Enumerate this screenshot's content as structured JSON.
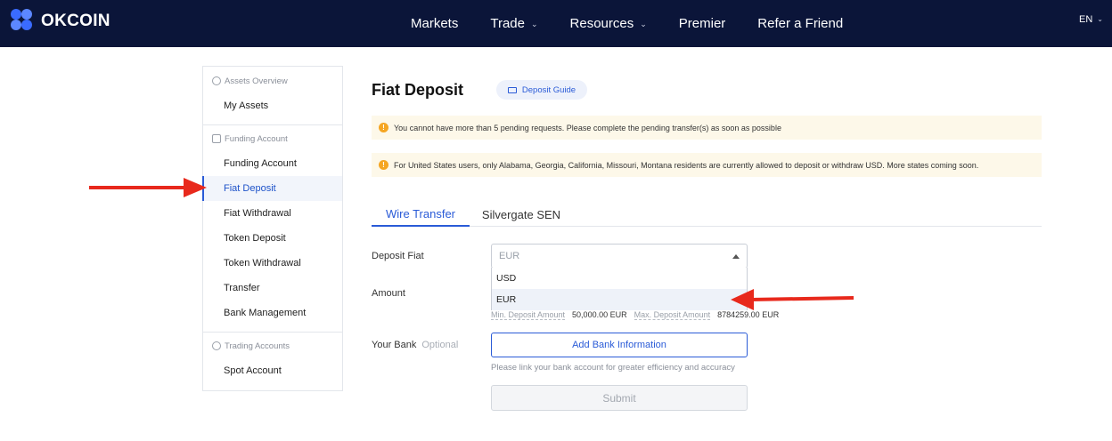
{
  "brand": {
    "name": "OKCOIN"
  },
  "nav": {
    "items": [
      {
        "label": "Markets",
        "dropdown": false
      },
      {
        "label": "Trade",
        "dropdown": true
      },
      {
        "label": "Resources",
        "dropdown": true
      },
      {
        "label": "Premier",
        "dropdown": false
      },
      {
        "label": "Refer a Friend",
        "dropdown": false
      }
    ],
    "lang": "EN"
  },
  "sidebar": {
    "groups": [
      {
        "header": "Assets Overview",
        "items": [
          "My Assets"
        ]
      },
      {
        "header": "Funding Account",
        "items": [
          "Funding Account",
          "Fiat Deposit",
          "Fiat Withdrawal",
          "Token Deposit",
          "Token Withdrawal",
          "Transfer",
          "Bank Management"
        ]
      },
      {
        "header": "Trading Accounts",
        "items": [
          "Spot Account"
        ]
      }
    ],
    "active": "Fiat Deposit"
  },
  "page": {
    "title": "Fiat Deposit",
    "guide_button": "Deposit Guide"
  },
  "notices": [
    "You cannot have more than 5 pending requests. Please complete the pending transfer(s) as soon as possible",
    "For United States users, only Alabama, Georgia, California, Missouri, Montana residents are currently allowed to deposit or withdraw USD. More states coming soon."
  ],
  "tabs": [
    "Wire Transfer",
    "Silvergate SEN"
  ],
  "form": {
    "deposit_fiat_label": "Deposit Fiat",
    "deposit_fiat_placeholder": "EUR",
    "options": [
      "USD",
      "EUR"
    ],
    "highlighted_option": "EUR",
    "amount_label": "Amount",
    "min_label": "Min. Deposit Amount",
    "min_value": "50,000.00 EUR",
    "max_label": "Max. Deposit Amount",
    "max_value": "8784259.00 EUR",
    "bank_label": "Your Bank",
    "bank_optional": "Optional",
    "add_bank_button": "Add Bank Information",
    "bank_hint": "Please link your bank account for greater efficiency and accuracy",
    "submit_button": "Submit"
  },
  "colors": {
    "nav_bg": "#0b1539",
    "accent": "#2a5bd7",
    "annotation_red": "#e8291c",
    "notice_bg": "#fdf8e9"
  }
}
